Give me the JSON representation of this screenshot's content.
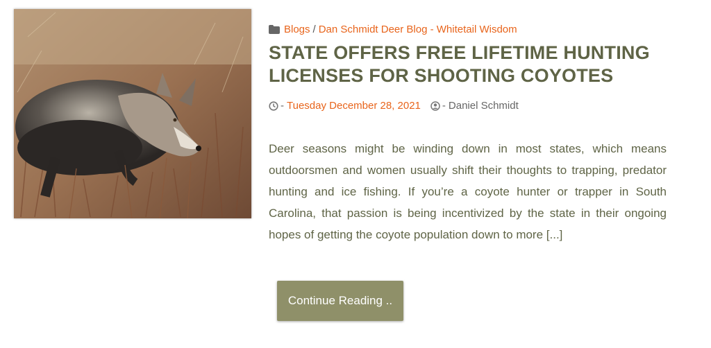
{
  "post": {
    "image_alt": "Coyote in tall brush",
    "categories": [
      "Blogs",
      "Dan Schmidt Deer Blog - Whitetail Wisdom"
    ],
    "category_separator": "/",
    "title": "STATE OFFERS FREE LIFETIME HUNTING LICENSES FOR SHOOTING COYOTES",
    "date": "Tuesday December 28, 2021",
    "author": "Daniel Schmidt",
    "meta_dash": "-",
    "excerpt": "Deer seasons might be winding down in most states, which means outdoorsmen and women usually shift their thoughts to trapping, predator hunting and ice fishing. If you’re a coyote hunter or trapper in South Carolina, that passion is being incentivized by the state in their ongoing hopes of getting the coyote population down to more [...]",
    "button_label": "Continue Reading .."
  },
  "icons": {
    "category": "folder-icon",
    "date": "clock-icon",
    "author": "user-circle-icon"
  },
  "colors": {
    "link": "#e8641b",
    "title": "#5f6446",
    "button_bg": "#8f9069"
  }
}
